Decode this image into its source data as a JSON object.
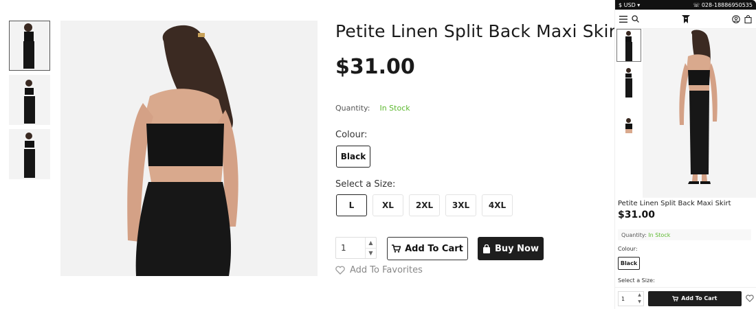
{
  "product": {
    "title": "Petite Linen Split Back Maxi Skirt",
    "price": "$31.00",
    "quantity_label": "Quantity:",
    "stock_status": "In Stock",
    "colour_label": "Colour:",
    "colour_selected": "Black",
    "size_label": "Select a Size:",
    "sizes": [
      "L",
      "XL",
      "2XL",
      "3XL",
      "4XL"
    ],
    "selected_size": "L",
    "quantity_value": "1",
    "add_to_cart_label": "Add To Cart",
    "buy_now_label": "Buy Now",
    "favorites_label": "Add To Favorites"
  },
  "mobile": {
    "currency": "$ USD",
    "phone_number": "028-18886950535",
    "title": "Petite Linen Split Back Maxi Skirt",
    "price": "$31.00",
    "quantity_label": "Quantity:",
    "stock_status": "In Stock",
    "colour_label": "Colour:",
    "colour_selected": "Black",
    "size_label": "Select a Size:",
    "quantity_value": "1",
    "add_to_cart_label": "Add To Cart"
  },
  "colors": {
    "accent_dark": "#1e1e1e",
    "stock_green": "#5cb82e"
  },
  "icons": [
    "cart-icon",
    "bag-icon",
    "heart-icon",
    "menu-icon",
    "search-icon",
    "user-icon",
    "phone-icon"
  ]
}
